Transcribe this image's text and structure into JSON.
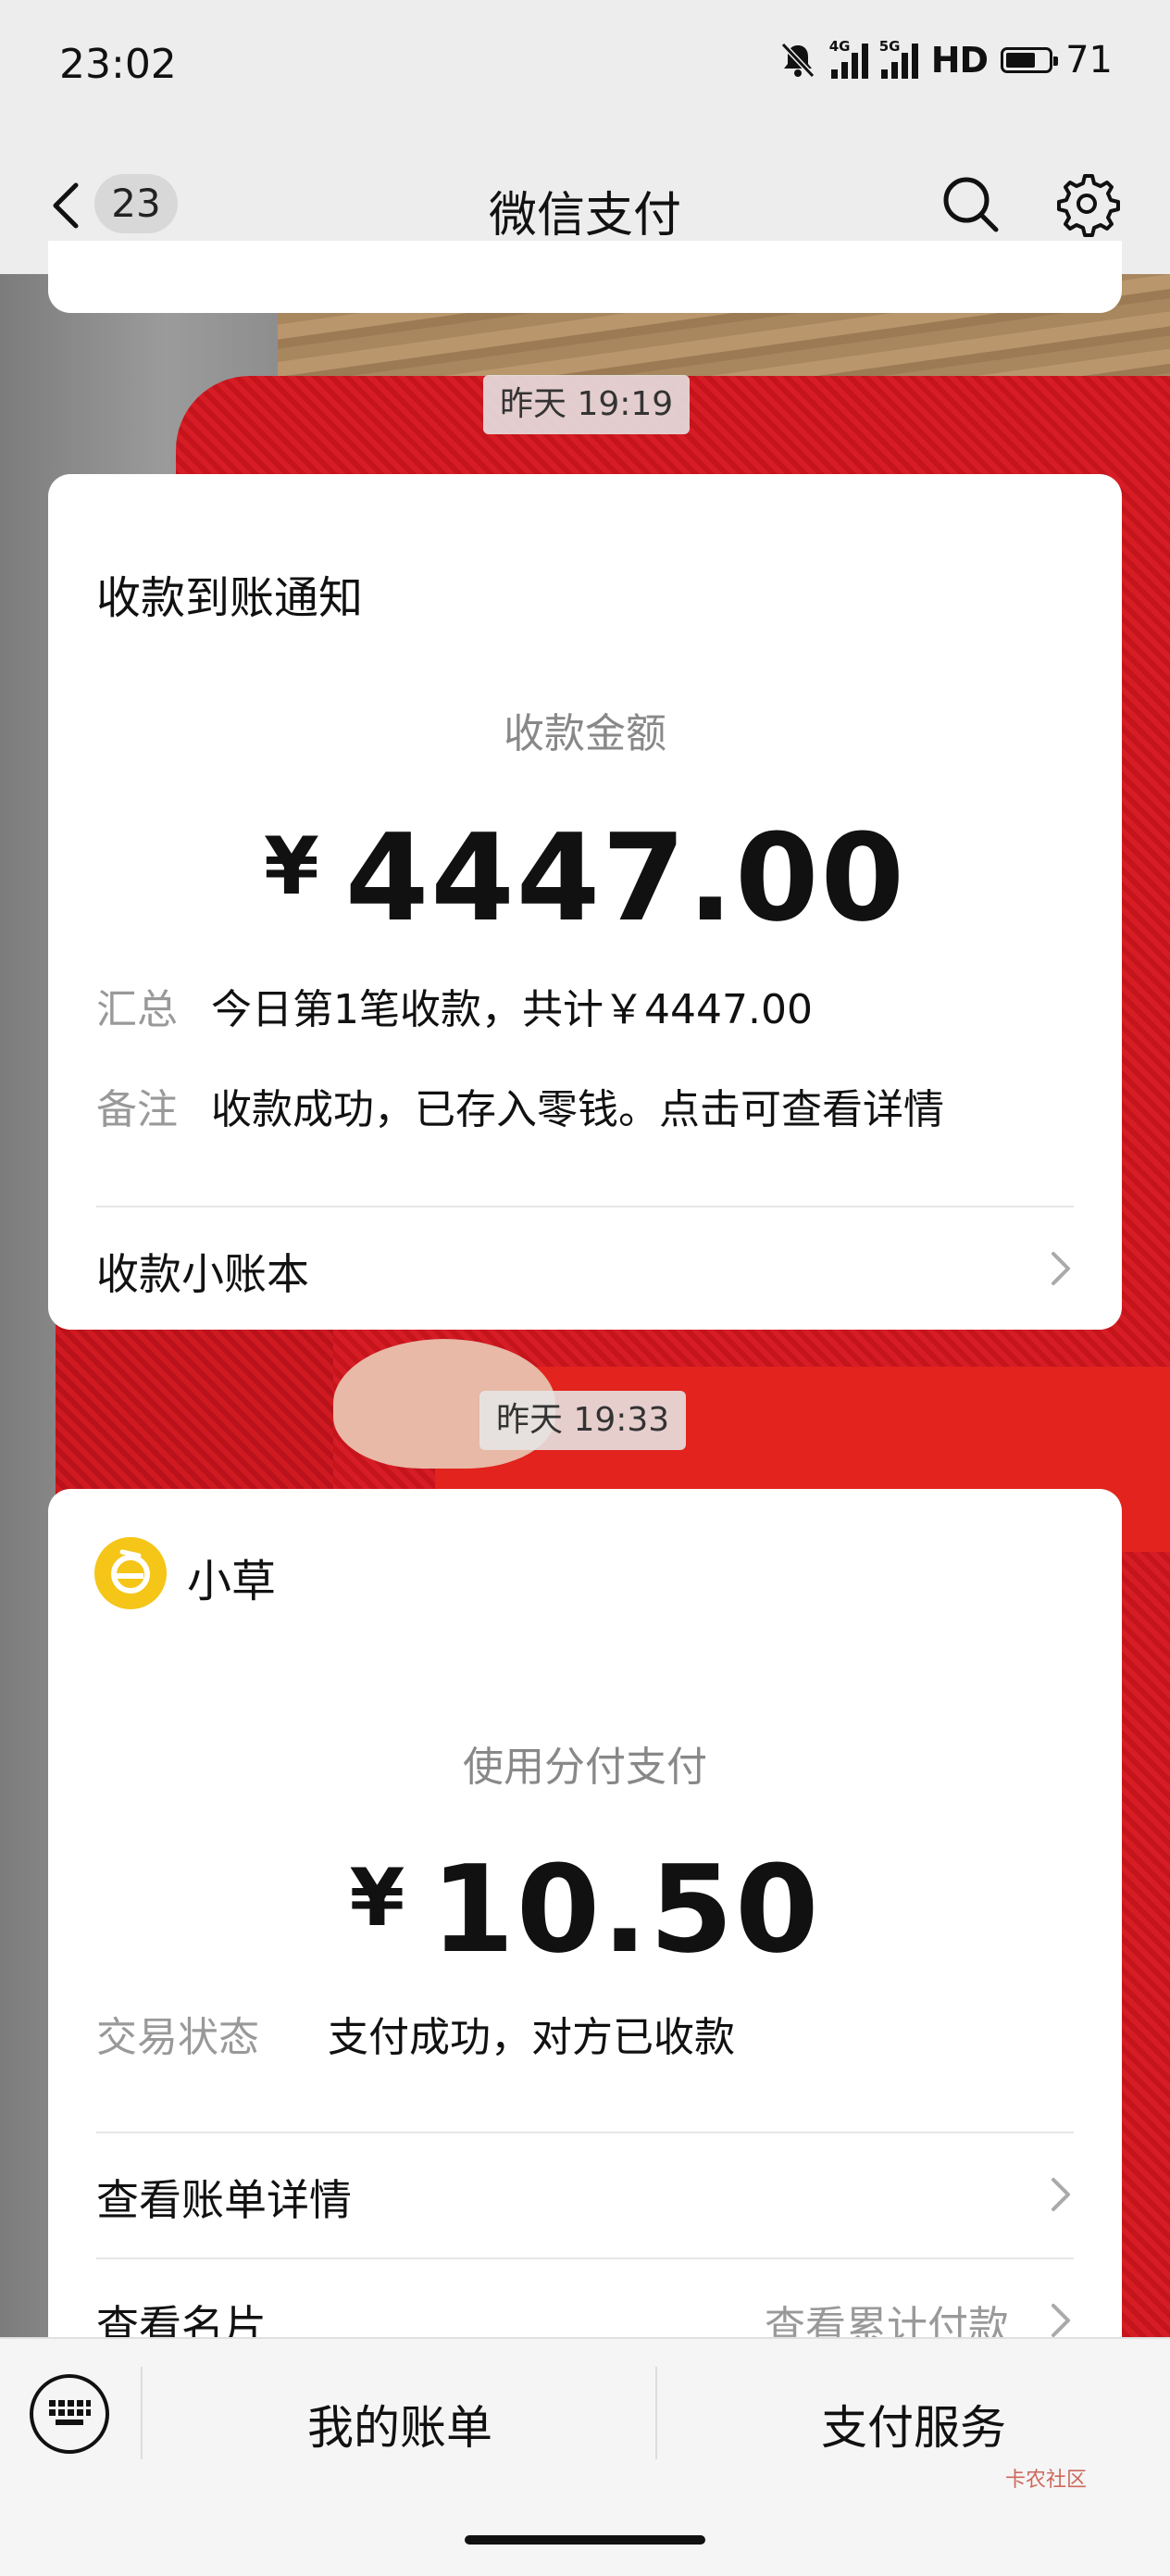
{
  "status_bar": {
    "time": "23:02",
    "net1": "4G",
    "net2": "5G",
    "hd": "HD",
    "battery": "71",
    "battery_level": 0.71
  },
  "nav": {
    "back_count": "23",
    "title": "微信支付"
  },
  "messages": [
    {
      "time": "昨天 19:19",
      "title": "收款到账通知",
      "amount_label": "收款金额",
      "currency": "¥",
      "amount": "4447.00",
      "rows": [
        {
          "label": "汇总",
          "value": "今日第1笔收款，共计￥4447.00"
        },
        {
          "label": "备注",
          "value": "收款成功，已存入零钱。点击可查看详情"
        }
      ],
      "link": "收款小账本"
    },
    {
      "time": "昨天 19:33",
      "merchant": "小草",
      "amount_label": "使用分付支付",
      "currency": "¥",
      "amount": "10.50",
      "rows": [
        {
          "label": "交易状态",
          "value": "支付成功，对方已收款"
        }
      ],
      "links": [
        {
          "text": "查看账单详情",
          "right": ""
        },
        {
          "text": "查看名片",
          "right": "查看累计付款"
        }
      ]
    }
  ],
  "bottom_bar": {
    "my_bill": "我的账单",
    "pay_service": "支付服务"
  },
  "watermark": "卡农社区",
  "colors": {
    "merchant_logo": "#f5c518",
    "page_bg": "#ededed"
  }
}
